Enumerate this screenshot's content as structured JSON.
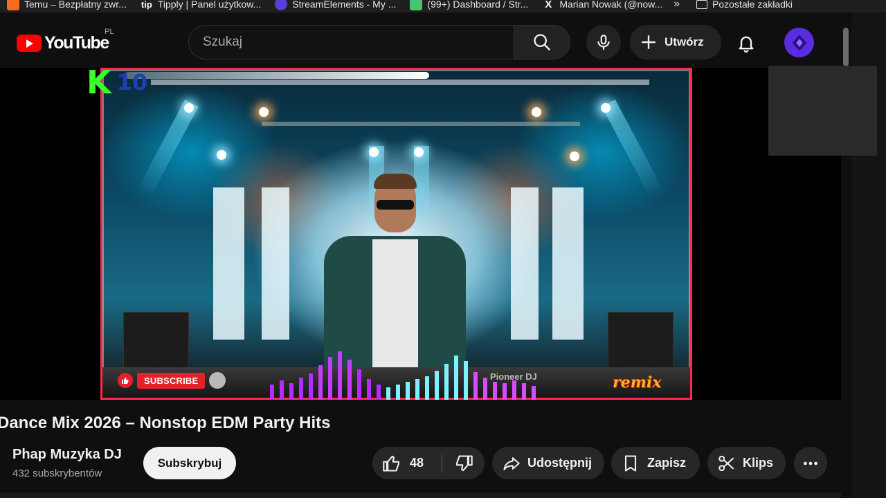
{
  "bookmarks": [
    {
      "label": "Temu – Bezpłatny zwr...",
      "icon": "temu-icon"
    },
    {
      "label": "Tipply | Panel użytkow...",
      "icon": "tipply-icon"
    },
    {
      "label": "StreamElements - My ...",
      "icon": "streamelements-icon"
    },
    {
      "label": "(99+) Dashboard / Str...",
      "icon": "discord-icon"
    },
    {
      "label": "Marian Nowak (@now...",
      "icon": "x-icon"
    }
  ],
  "bookmarks_overflow": "»",
  "bookmarks_folder": "Pozostałe zakładki",
  "bookmark_icon_texts": {
    "tip": "tip",
    "x": "X"
  },
  "header": {
    "logo_text": "YouTube",
    "region": "PL",
    "search_placeholder": "Szukaj",
    "create_label": "Utwórz"
  },
  "video": {
    "overlay_k": "K",
    "overlay_num": "10",
    "subscribe_overlay": "SUBSCRIBE",
    "remix_text": "remix",
    "deck_brand": "Pioneer DJ"
  },
  "title": "Dance Mix 2026 – Nonstop EDM Party Hits",
  "channel": {
    "name": "Phap Muzyka DJ",
    "subscribers": "432 subskrybentów",
    "subscribe_label": "Subskrybuj"
  },
  "actions": {
    "likes": "48",
    "share": "Udostępnij",
    "save": "Zapisz",
    "clips": "Klips"
  },
  "colors": {
    "background": "#0f0f0f",
    "pill": "#272727",
    "brand_red": "#ff0000",
    "avatar": "#5b2be0"
  }
}
